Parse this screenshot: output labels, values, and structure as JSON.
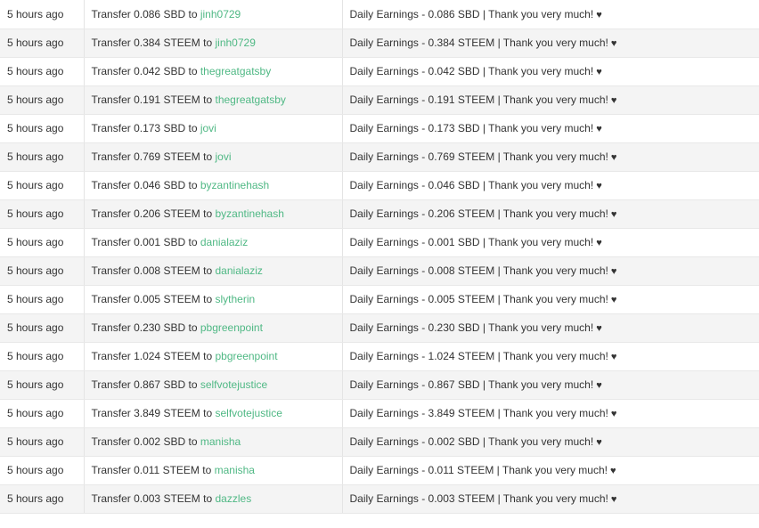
{
  "labels": {
    "transfer_word": "Transfer",
    "to_word": "to",
    "heart": "♥"
  },
  "rows": [
    {
      "time": "5 hours ago",
      "amount": "0.086",
      "currency": "SBD",
      "account": "jinh0729",
      "memo": "Daily Earnings - 0.086 SBD | Thank you very much!"
    },
    {
      "time": "5 hours ago",
      "amount": "0.384",
      "currency": "STEEM",
      "account": "jinh0729",
      "memo": "Daily Earnings - 0.384 STEEM | Thank you very much!"
    },
    {
      "time": "5 hours ago",
      "amount": "0.042",
      "currency": "SBD",
      "account": "thegreatgatsby",
      "memo": "Daily Earnings - 0.042 SBD | Thank you very much!"
    },
    {
      "time": "5 hours ago",
      "amount": "0.191",
      "currency": "STEEM",
      "account": "thegreatgatsby",
      "memo": "Daily Earnings - 0.191 STEEM | Thank you very much!"
    },
    {
      "time": "5 hours ago",
      "amount": "0.173",
      "currency": "SBD",
      "account": "jovi",
      "memo": "Daily Earnings - 0.173 SBD | Thank you very much!"
    },
    {
      "time": "5 hours ago",
      "amount": "0.769",
      "currency": "STEEM",
      "account": "jovi",
      "memo": "Daily Earnings - 0.769 STEEM | Thank you very much!"
    },
    {
      "time": "5 hours ago",
      "amount": "0.046",
      "currency": "SBD",
      "account": "byzantinehash",
      "memo": "Daily Earnings - 0.046 SBD | Thank you very much!"
    },
    {
      "time": "5 hours ago",
      "amount": "0.206",
      "currency": "STEEM",
      "account": "byzantinehash",
      "memo": "Daily Earnings - 0.206 STEEM | Thank you very much!"
    },
    {
      "time": "5 hours ago",
      "amount": "0.001",
      "currency": "SBD",
      "account": "danialaziz",
      "memo": "Daily Earnings - 0.001 SBD | Thank you very much!"
    },
    {
      "time": "5 hours ago",
      "amount": "0.008",
      "currency": "STEEM",
      "account": "danialaziz",
      "memo": "Daily Earnings - 0.008 STEEM | Thank you very much!"
    },
    {
      "time": "5 hours ago",
      "amount": "0.005",
      "currency": "STEEM",
      "account": "slytherin",
      "memo": "Daily Earnings - 0.005 STEEM | Thank you very much!"
    },
    {
      "time": "5 hours ago",
      "amount": "0.230",
      "currency": "SBD",
      "account": "pbgreenpoint",
      "memo": "Daily Earnings - 0.230 SBD | Thank you very much!"
    },
    {
      "time": "5 hours ago",
      "amount": "1.024",
      "currency": "STEEM",
      "account": "pbgreenpoint",
      "memo": "Daily Earnings - 1.024 STEEM | Thank you very much!"
    },
    {
      "time": "5 hours ago",
      "amount": "0.867",
      "currency": "SBD",
      "account": "selfvotejustice",
      "memo": "Daily Earnings - 0.867 SBD | Thank you very much!"
    },
    {
      "time": "5 hours ago",
      "amount": "3.849",
      "currency": "STEEM",
      "account": "selfvotejustice",
      "memo": "Daily Earnings - 3.849 STEEM | Thank you very much!"
    },
    {
      "time": "5 hours ago",
      "amount": "0.002",
      "currency": "SBD",
      "account": "manisha",
      "memo": "Daily Earnings - 0.002 SBD | Thank you very much!"
    },
    {
      "time": "5 hours ago",
      "amount": "0.011",
      "currency": "STEEM",
      "account": "manisha",
      "memo": "Daily Earnings - 0.011 STEEM | Thank you very much!"
    },
    {
      "time": "5 hours ago",
      "amount": "0.003",
      "currency": "STEEM",
      "account": "dazzles",
      "memo": "Daily Earnings - 0.003 STEEM | Thank you very much!"
    }
  ]
}
